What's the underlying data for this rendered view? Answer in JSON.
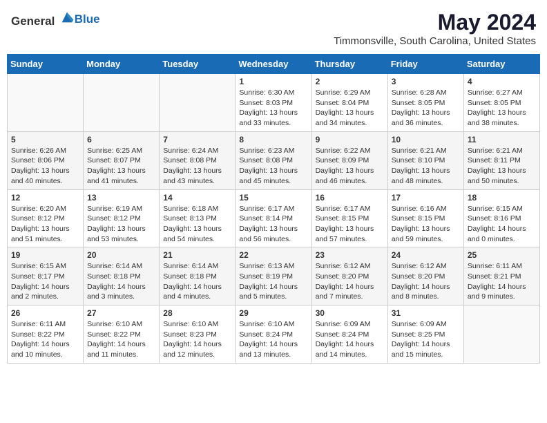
{
  "header": {
    "logo_general": "General",
    "logo_blue": "Blue",
    "title": "May 2024",
    "subtitle": "Timmonsville, South Carolina, United States"
  },
  "weekdays": [
    "Sunday",
    "Monday",
    "Tuesday",
    "Wednesday",
    "Thursday",
    "Friday",
    "Saturday"
  ],
  "weeks": [
    [
      {
        "day": "",
        "info": ""
      },
      {
        "day": "",
        "info": ""
      },
      {
        "day": "",
        "info": ""
      },
      {
        "day": "1",
        "info": "Sunrise: 6:30 AM\nSunset: 8:03 PM\nDaylight: 13 hours\nand 33 minutes."
      },
      {
        "day": "2",
        "info": "Sunrise: 6:29 AM\nSunset: 8:04 PM\nDaylight: 13 hours\nand 34 minutes."
      },
      {
        "day": "3",
        "info": "Sunrise: 6:28 AM\nSunset: 8:05 PM\nDaylight: 13 hours\nand 36 minutes."
      },
      {
        "day": "4",
        "info": "Sunrise: 6:27 AM\nSunset: 8:05 PM\nDaylight: 13 hours\nand 38 minutes."
      }
    ],
    [
      {
        "day": "5",
        "info": "Sunrise: 6:26 AM\nSunset: 8:06 PM\nDaylight: 13 hours\nand 40 minutes."
      },
      {
        "day": "6",
        "info": "Sunrise: 6:25 AM\nSunset: 8:07 PM\nDaylight: 13 hours\nand 41 minutes."
      },
      {
        "day": "7",
        "info": "Sunrise: 6:24 AM\nSunset: 8:08 PM\nDaylight: 13 hours\nand 43 minutes."
      },
      {
        "day": "8",
        "info": "Sunrise: 6:23 AM\nSunset: 8:08 PM\nDaylight: 13 hours\nand 45 minutes."
      },
      {
        "day": "9",
        "info": "Sunrise: 6:22 AM\nSunset: 8:09 PM\nDaylight: 13 hours\nand 46 minutes."
      },
      {
        "day": "10",
        "info": "Sunrise: 6:21 AM\nSunset: 8:10 PM\nDaylight: 13 hours\nand 48 minutes."
      },
      {
        "day": "11",
        "info": "Sunrise: 6:21 AM\nSunset: 8:11 PM\nDaylight: 13 hours\nand 50 minutes."
      }
    ],
    [
      {
        "day": "12",
        "info": "Sunrise: 6:20 AM\nSunset: 8:12 PM\nDaylight: 13 hours\nand 51 minutes."
      },
      {
        "day": "13",
        "info": "Sunrise: 6:19 AM\nSunset: 8:12 PM\nDaylight: 13 hours\nand 53 minutes."
      },
      {
        "day": "14",
        "info": "Sunrise: 6:18 AM\nSunset: 8:13 PM\nDaylight: 13 hours\nand 54 minutes."
      },
      {
        "day": "15",
        "info": "Sunrise: 6:17 AM\nSunset: 8:14 PM\nDaylight: 13 hours\nand 56 minutes."
      },
      {
        "day": "16",
        "info": "Sunrise: 6:17 AM\nSunset: 8:15 PM\nDaylight: 13 hours\nand 57 minutes."
      },
      {
        "day": "17",
        "info": "Sunrise: 6:16 AM\nSunset: 8:15 PM\nDaylight: 13 hours\nand 59 minutes."
      },
      {
        "day": "18",
        "info": "Sunrise: 6:15 AM\nSunset: 8:16 PM\nDaylight: 14 hours\nand 0 minutes."
      }
    ],
    [
      {
        "day": "19",
        "info": "Sunrise: 6:15 AM\nSunset: 8:17 PM\nDaylight: 14 hours\nand 2 minutes."
      },
      {
        "day": "20",
        "info": "Sunrise: 6:14 AM\nSunset: 8:18 PM\nDaylight: 14 hours\nand 3 minutes."
      },
      {
        "day": "21",
        "info": "Sunrise: 6:14 AM\nSunset: 8:18 PM\nDaylight: 14 hours\nand 4 minutes."
      },
      {
        "day": "22",
        "info": "Sunrise: 6:13 AM\nSunset: 8:19 PM\nDaylight: 14 hours\nand 5 minutes."
      },
      {
        "day": "23",
        "info": "Sunrise: 6:12 AM\nSunset: 8:20 PM\nDaylight: 14 hours\nand 7 minutes."
      },
      {
        "day": "24",
        "info": "Sunrise: 6:12 AM\nSunset: 8:20 PM\nDaylight: 14 hours\nand 8 minutes."
      },
      {
        "day": "25",
        "info": "Sunrise: 6:11 AM\nSunset: 8:21 PM\nDaylight: 14 hours\nand 9 minutes."
      }
    ],
    [
      {
        "day": "26",
        "info": "Sunrise: 6:11 AM\nSunset: 8:22 PM\nDaylight: 14 hours\nand 10 minutes."
      },
      {
        "day": "27",
        "info": "Sunrise: 6:10 AM\nSunset: 8:22 PM\nDaylight: 14 hours\nand 11 minutes."
      },
      {
        "day": "28",
        "info": "Sunrise: 6:10 AM\nSunset: 8:23 PM\nDaylight: 14 hours\nand 12 minutes."
      },
      {
        "day": "29",
        "info": "Sunrise: 6:10 AM\nSunset: 8:24 PM\nDaylight: 14 hours\nand 13 minutes."
      },
      {
        "day": "30",
        "info": "Sunrise: 6:09 AM\nSunset: 8:24 PM\nDaylight: 14 hours\nand 14 minutes."
      },
      {
        "day": "31",
        "info": "Sunrise: 6:09 AM\nSunset: 8:25 PM\nDaylight: 14 hours\nand 15 minutes."
      },
      {
        "day": "",
        "info": ""
      }
    ]
  ]
}
